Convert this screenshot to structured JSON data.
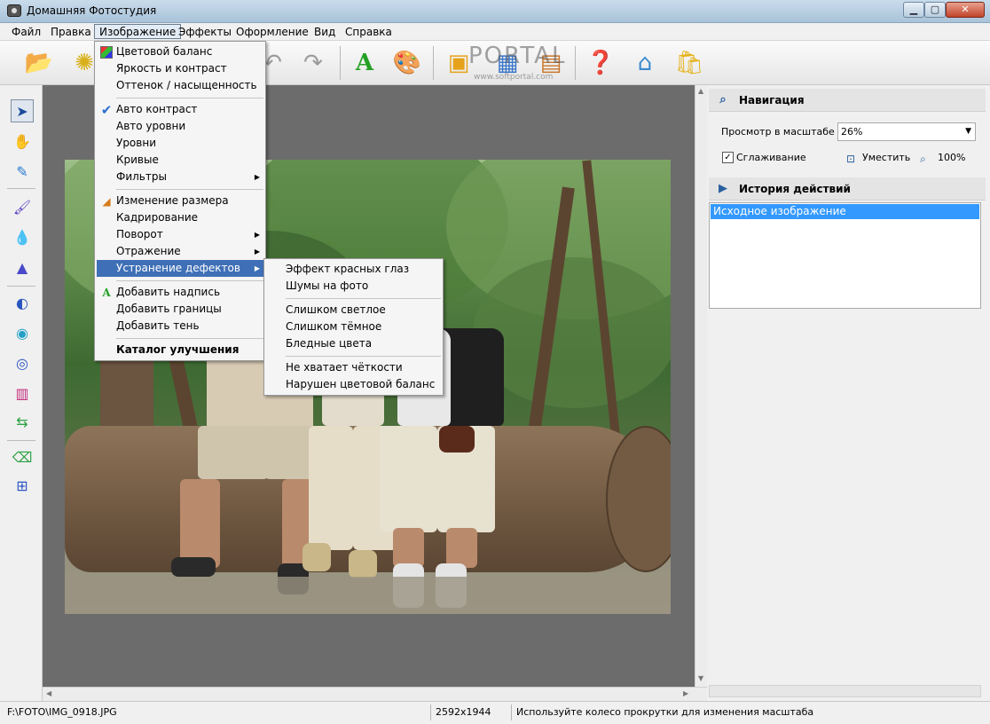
{
  "window": {
    "title": "Домашняя Фотостудия",
    "minimize_icon": "minimize-icon",
    "maximize_icon": "maximize-icon",
    "close_icon": "close-icon"
  },
  "menubar": [
    "Файл",
    "Правка",
    "Изображение",
    "Эффекты",
    "Оформление",
    "Вид",
    "Справка"
  ],
  "image_menu": {
    "items": [
      {
        "label": "Цветовой баланс",
        "icon": "color-balance-icon"
      },
      {
        "label": "Яркость и контраст"
      },
      {
        "label": "Оттенок / насыщенность"
      },
      {
        "label": "Авто контраст",
        "checked": true
      },
      {
        "label": "Авто уровни"
      },
      {
        "label": "Уровни"
      },
      {
        "label": "Кривые"
      },
      {
        "label": "Фильтры",
        "submenu": true
      },
      {
        "label": "Изменение размера",
        "icon": "resize-icon"
      },
      {
        "label": "Кадрирование"
      },
      {
        "label": "Поворот",
        "submenu": true
      },
      {
        "label": "Отражение",
        "submenu": true
      },
      {
        "label": "Устранение дефектов",
        "submenu": true,
        "highlighted": true
      },
      {
        "label": "Добавить надпись",
        "icon": "text-icon"
      },
      {
        "label": "Добавить границы"
      },
      {
        "label": "Добавить тень"
      },
      {
        "label": "Каталог улучшения",
        "bold": true
      }
    ]
  },
  "defects_submenu": {
    "items": [
      "Эффект красных глаз",
      "Шумы на фото",
      "Слишком светлое",
      "Слишком тёмное",
      "Бледные цвета",
      "Не хватает чёткости",
      "Нарушен цветовой баланс"
    ]
  },
  "watermark": {
    "brand": "PORTAL",
    "url": "www.softportal.com"
  },
  "navigation": {
    "title": "Навигация",
    "zoom_label": "Просмотр в масштабе",
    "zoom_value": "26%",
    "smoothing_label": "Сглаживание",
    "smoothing_checked": true,
    "fit_label": "Уместить",
    "full_label": "100%"
  },
  "history": {
    "title": "История действий",
    "items": [
      "Исходное изображение"
    ]
  },
  "status": {
    "path": "F:\\FOTO\\IMG_0918.JPG",
    "dimensions": "2592x1944",
    "hint": "Используйте колесо прокрутки для изменения масштаба"
  }
}
